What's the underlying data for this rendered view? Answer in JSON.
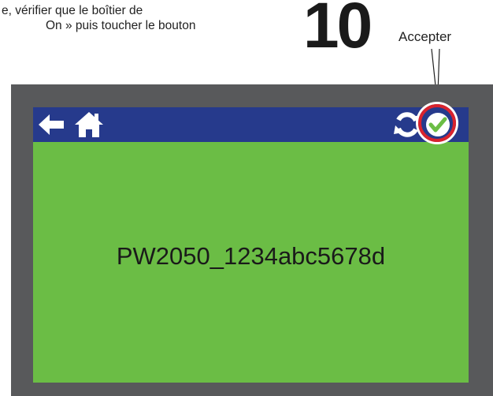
{
  "instruction": {
    "line1": "e, vérifier que le boîtier de",
    "line2": "On » puis toucher le bouton"
  },
  "step_number": "10",
  "callout": {
    "label": "Accepter"
  },
  "topbar": {
    "icons": [
      "back-arrow-icon",
      "home-icon",
      "refresh-icon",
      "checkmark-icon"
    ],
    "color": "#263a8c"
  },
  "screen": {
    "device_name": "PW2050_1234abc5678d",
    "background": "#6bbd45"
  },
  "colors": {
    "bezel": "#58595b",
    "highlight": "#d9232e",
    "check": "#6bbd45"
  }
}
